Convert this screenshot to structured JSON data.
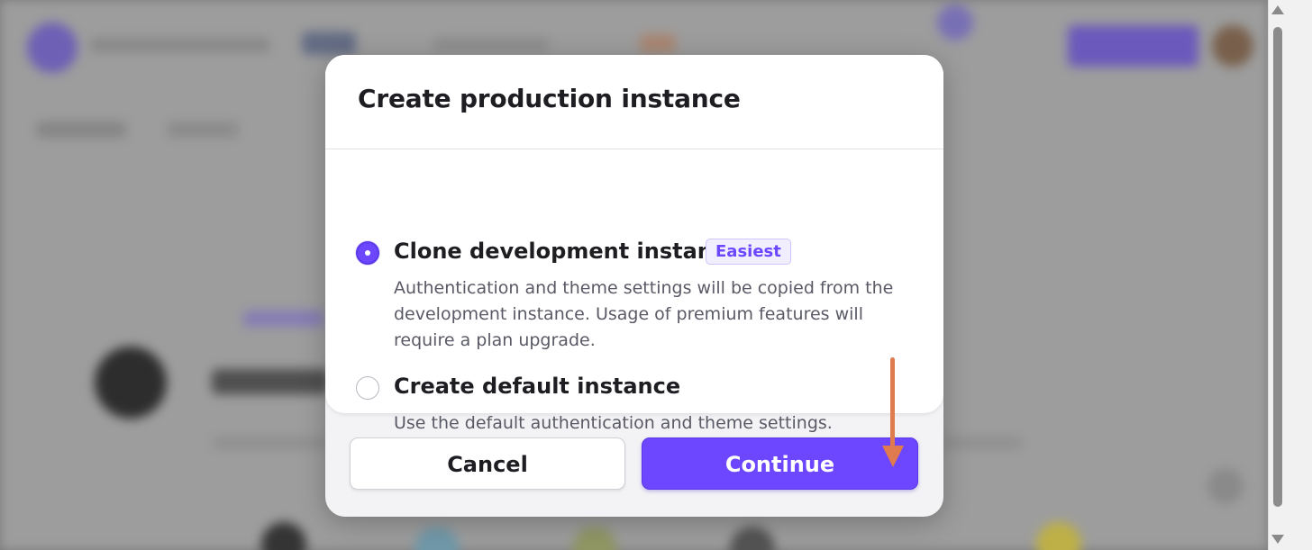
{
  "modal": {
    "title": "Create production instance",
    "options": [
      {
        "title": "Clone development instance",
        "badge": "Easiest",
        "description": "Authentication and theme settings will be copied from the development instance. Usage of premium features will require a plan upgrade.",
        "selected": true
      },
      {
        "title": "Create default instance",
        "description": "Use the default authentication and theme settings.",
        "selected": false
      }
    ],
    "buttons": {
      "cancel": "Cancel",
      "continue": "Continue"
    }
  },
  "colors": {
    "accent": "#6c47ff",
    "annotation_arrow": "#e07a4f"
  }
}
